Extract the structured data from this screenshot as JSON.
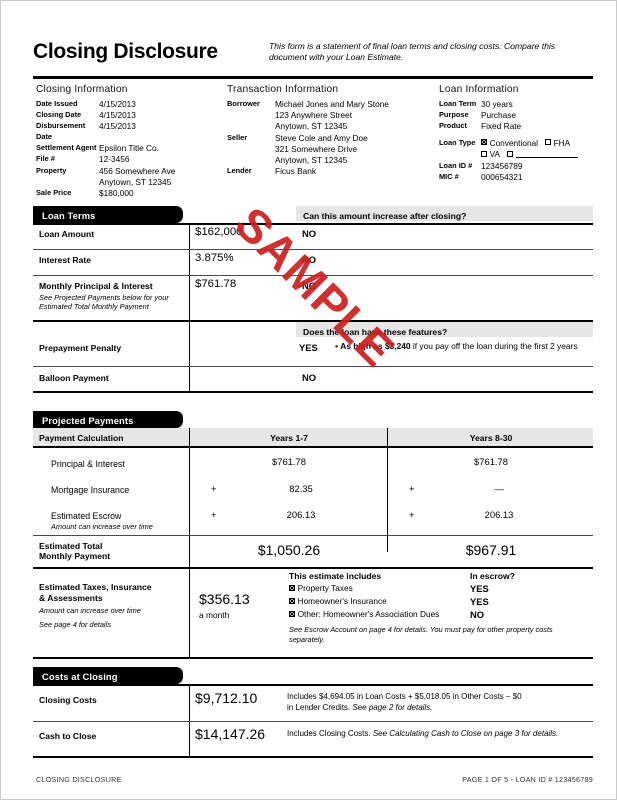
{
  "document": {
    "title": "Closing Disclosure",
    "subtitle": "This form is a statement of final loan terms and closing costs. Compare this document with your Loan Estimate."
  },
  "closing_information": {
    "heading": "Closing Information",
    "rows": [
      {
        "label": "Date Issued",
        "value": "4/15/2013"
      },
      {
        "label": "Closing Date",
        "value": "4/15/2013"
      },
      {
        "label": "Disbursement Date",
        "value": "4/15/2013"
      },
      {
        "label": "Settlement Agent",
        "value": "Epsilon Title Co."
      },
      {
        "label": "File #",
        "value": "12-3456"
      },
      {
        "label": "Property",
        "value": "456 Somewhere Ave"
      },
      {
        "label": "",
        "value": "Anytown, ST 12345"
      },
      {
        "label": "Sale Price",
        "value": "$180,000"
      }
    ]
  },
  "transaction_information": {
    "heading": "Transaction Information",
    "rows": [
      {
        "label": "Borrower",
        "value": "Michael Jones and Mary Stone"
      },
      {
        "label": "",
        "value": "123 Anywhere Street"
      },
      {
        "label": "",
        "value": "Anytown, ST 12345"
      },
      {
        "label": "Seller",
        "value": "Steve Cole and Amy Doe"
      },
      {
        "label": "",
        "value": "321 Somewhere Drive"
      },
      {
        "label": "",
        "value": "Anytown, ST 12345"
      },
      {
        "label": "Lender",
        "value": "Ficus Bank"
      }
    ]
  },
  "loan_information": {
    "heading": "Loan Information",
    "rows": [
      {
        "label": "Loan Term",
        "value": "30 years"
      },
      {
        "label": "Purpose",
        "value": "Purchase"
      },
      {
        "label": "Product",
        "value": "Fixed Rate"
      }
    ],
    "loan_type_label": "Loan Type",
    "loan_type_options": [
      {
        "label": "Conventional",
        "checked": true
      },
      {
        "label": "FHA",
        "checked": false
      },
      {
        "label": "VA",
        "checked": false
      },
      {
        "label": "",
        "checked": false
      }
    ],
    "id_rows": [
      {
        "label": "Loan ID #",
        "value": "123456789"
      },
      {
        "label": "MIC #",
        "value": "000654321"
      }
    ]
  },
  "loan_terms": {
    "section_title": "Loan Terms",
    "column_header_increase": "Can this amount increase after closing?",
    "column_header_features": "Does the loan have these features?",
    "rows": [
      {
        "label": "Loan Amount",
        "value": "$162,000",
        "answer": "NO",
        "sublabel": "",
        "note": ""
      },
      {
        "label": "Interest Rate",
        "value": "3.875%",
        "answer": "NO",
        "sublabel": "",
        "note": ""
      },
      {
        "label": "Monthly Principal & Interest",
        "value": "$761.78",
        "answer": "NO",
        "sublabel": "See Projected Payments below for your Estimated Total Monthly Payment",
        "note": ""
      },
      {
        "label": "Prepayment Penalty",
        "value": "",
        "answer": "YES",
        "sublabel": "",
        "note_bullet": "•",
        "note_bold_1": "As high as $3,240",
        "note_rest": " if you pay off the loan during the first 2 years"
      },
      {
        "label": "Balloon Payment",
        "value": "",
        "answer": "NO",
        "sublabel": "",
        "note": ""
      }
    ]
  },
  "projected_payments": {
    "section_title": "Projected Payments",
    "calc_header": "Payment Calculation",
    "column_1": "Years 1-7",
    "column_2": "Years 8-30",
    "rows": [
      {
        "label": "Principal & Interest",
        "sublabel": "",
        "op1": "",
        "v1": "$761.78",
        "op2": "",
        "v2": "$761.78"
      },
      {
        "label": "Mortgage Insurance",
        "sublabel": "",
        "op1": "+",
        "v1": "82.35",
        "op2": "+",
        "v2": "—"
      },
      {
        "label": "Estimated Escrow",
        "sublabel": "Amount can increase over time",
        "op1": "+",
        "v1": "206.13",
        "op2": "+",
        "v2": "206.13"
      }
    ],
    "total_label_line1": "Estimated Total",
    "total_label_line2": "Monthly Payment",
    "total_1": "$1,050.26",
    "total_2": "$967.91",
    "taxes": {
      "label_line1": "Estimated Taxes, Insurance",
      "label_line2": "& Assessments",
      "sub_line1": "Amount can increase over time",
      "sub_line2": "See page 4 for details",
      "amount": "$356.13",
      "amount_sub": "a month",
      "includes_header": "This estimate includes",
      "escrow_header": "In escrow?",
      "items": [
        {
          "label": "Property Taxes",
          "checked": true,
          "escrow": "YES"
        },
        {
          "label": "Homeowner's Insurance",
          "checked": true,
          "escrow": "YES"
        },
        {
          "label": "Other: Homeowner's Association Dues",
          "checked": true,
          "escrow": "NO"
        }
      ],
      "footnote": "See Escrow Account on page 4 for details. You must pay for other property costs separately."
    }
  },
  "costs_at_closing": {
    "section_title": "Costs at Closing",
    "rows": [
      {
        "label": "Closing Costs",
        "value": "$9,712.10",
        "note_line1": "Includes $4,694.05 in Loan Costs + $5,018.05 in Other Costs – $0",
        "note_line2_plain": "in Lender Credits. ",
        "note_line2_italic": "See page 2 for details."
      },
      {
        "label": "Cash to Close",
        "value": "$14,147.26",
        "note_line1": "Includes Closing Costs. ",
        "note_line1_italic": "See Calculating Cash to Close on page 3 for details.",
        "note_line2_plain": "",
        "note_line2_italic": ""
      }
    ]
  },
  "watermark": {
    "text": "SAMPLE",
    "color": "#cc1f1f"
  },
  "footer": {
    "left": "CLOSING DISCLOSURE",
    "right": "PAGE 1 OF 5 - LOAN ID # 123456789"
  }
}
